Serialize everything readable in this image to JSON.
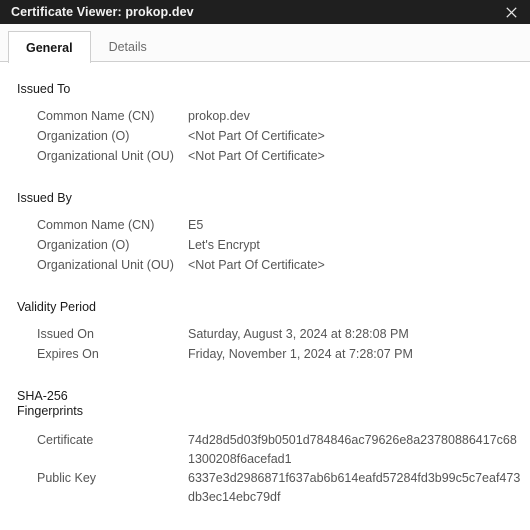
{
  "window": {
    "title": "Certificate Viewer: prokop.dev",
    "close_icon": "close-icon"
  },
  "tabs": [
    {
      "id": "general",
      "label": "General",
      "active": true
    },
    {
      "id": "details",
      "label": "Details",
      "active": false
    }
  ],
  "sections": {
    "issued_to": {
      "title": "Issued To",
      "rows": [
        {
          "label": "Common Name (CN)",
          "value": "prokop.dev"
        },
        {
          "label": "Organization (O)",
          "value": "<Not Part Of Certificate>"
        },
        {
          "label": "Organizational Unit (OU)",
          "value": "<Not Part Of Certificate>"
        }
      ]
    },
    "issued_by": {
      "title": "Issued By",
      "rows": [
        {
          "label": "Common Name (CN)",
          "value": "E5"
        },
        {
          "label": "Organization (O)",
          "value": "Let's Encrypt"
        },
        {
          "label": "Organizational Unit (OU)",
          "value": "<Not Part Of Certificate>"
        }
      ]
    },
    "validity_period": {
      "title": "Validity Period",
      "rows": [
        {
          "label": "Issued On",
          "value": "Saturday, August 3, 2024 at 8:28:08 PM"
        },
        {
          "label": "Expires On",
          "value": "Friday, November 1, 2024 at 7:28:07 PM"
        }
      ]
    },
    "fingerprints": {
      "title": "SHA-256\nFingerprints",
      "rows": [
        {
          "label": "Certificate",
          "value": "74d28d5d03f9b0501d784846ac79626e8a23780886417c681300208f6acefad1"
        },
        {
          "label": "Public Key",
          "value": "6337e3d2986871f637ab6b614eafd57284fd3b99c5c7eaf473db3ec14ebc79df"
        }
      ]
    }
  },
  "colors": {
    "titlebar_bg": "#1f1f1f",
    "titlebar_fg": "#f2f2f2",
    "content_bg": "#ffffff",
    "label_fg": "#555555",
    "heading_fg": "#1a1a1a",
    "border": "#cfcfcf"
  }
}
